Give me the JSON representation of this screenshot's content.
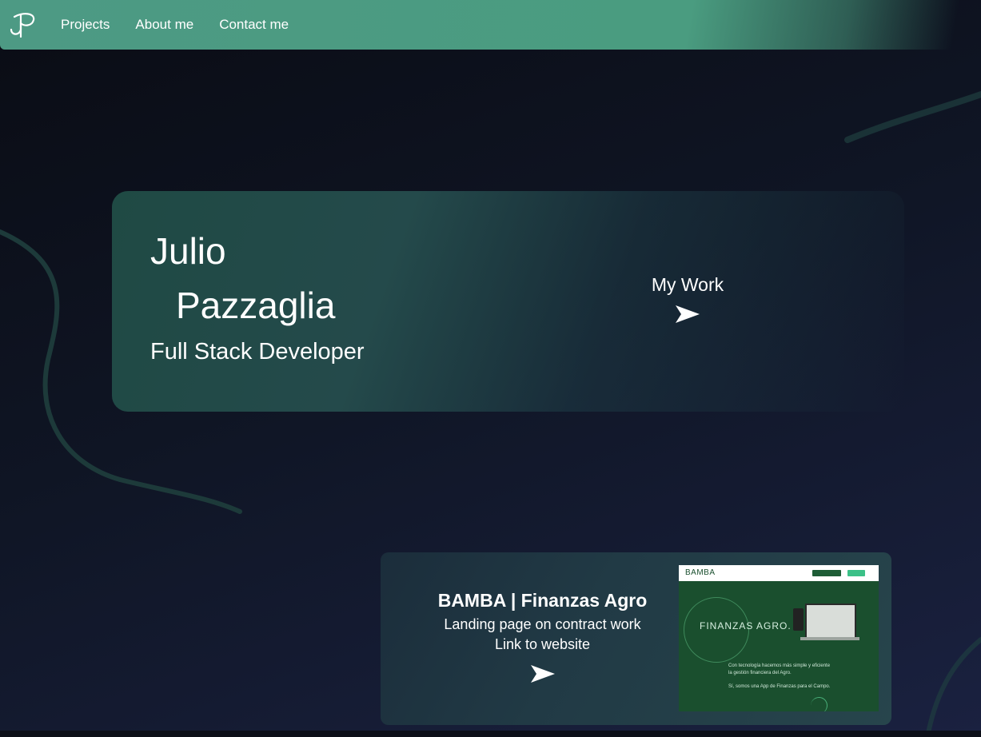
{
  "nav": {
    "logo_icon": "jp-monogram-icon",
    "links": [
      "Projects",
      "About me",
      "Contact me"
    ]
  },
  "hero": {
    "first_name": "Julio",
    "last_name": "Pazzaglia",
    "role": "Full Stack Developer",
    "cta_label": "My Work",
    "cta_icon": "paper-plane-arrow-icon"
  },
  "project": {
    "title": "BAMBA | Finanzas Agro",
    "description": "Landing page on contract work",
    "link_label": "Link to website",
    "link_icon": "paper-plane-arrow-icon",
    "thumbnail": {
      "brand": "BAMBA",
      "headline": "FINANZAS AGRO.",
      "line1": "Con tecnología hacemos más simple y eficiente",
      "line2": "la gestión financiera del Agro.",
      "line3": "Sí, somos una App de Finanzas para el Campo."
    }
  },
  "colors": {
    "nav_bg": "#4a9c80",
    "page_bg": "#0f1524",
    "card_bg": "#244a4b",
    "thumb_bg": "#1a4f2e"
  }
}
